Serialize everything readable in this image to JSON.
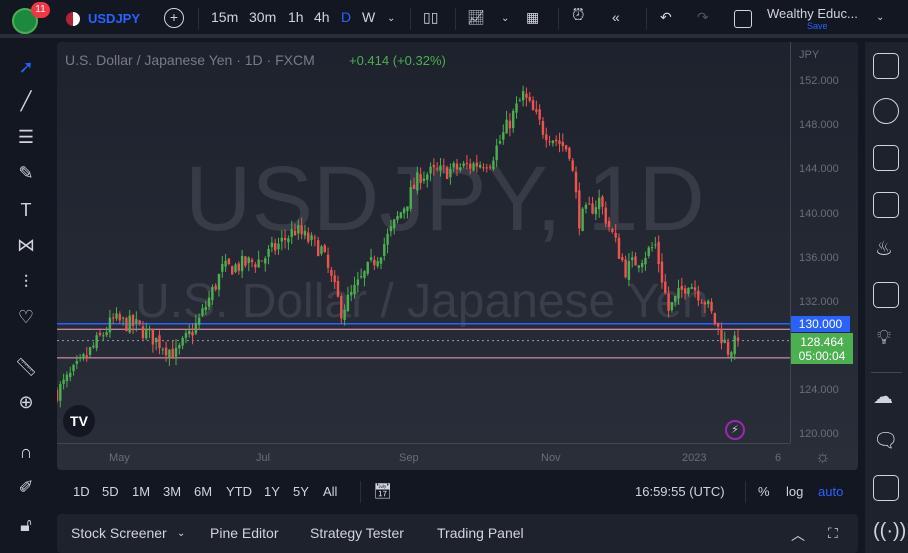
{
  "topbar": {
    "notif_count": "11",
    "symbol": "USDJPY",
    "intervals": [
      "15m",
      "30m",
      "1h",
      "4h",
      "D",
      "W"
    ],
    "layout_name": "Wealthy Educ...",
    "save_label": "Save"
  },
  "legend": {
    "title": "U.S. Dollar / Japanese Yen · 1D · FXCM",
    "change": "+0.414 (+0.32%)"
  },
  "watermark": {
    "symbol": "USDJPY, 1D",
    "name": "U.S. Dollar / Japanese Yen"
  },
  "price_axis": {
    "currency": "JPY",
    "ticks": [
      "152.000",
      "148.000",
      "144.000",
      "140.000",
      "136.000",
      "132.000",
      "124.000",
      "120.000"
    ],
    "line_label": "130.000",
    "last_price": "128.464",
    "countdown": "05:00:04"
  },
  "time_axis": {
    "labels": [
      "May",
      "Jul",
      "Sep",
      "Nov",
      "2023",
      "6"
    ]
  },
  "range_bar": {
    "ranges": [
      "1D",
      "5D",
      "1M",
      "3M",
      "6M",
      "YTD",
      "1Y",
      "5Y",
      "All"
    ],
    "clock": "16:59:55 (UTC)",
    "percent": "%",
    "log": "log",
    "auto": "auto"
  },
  "bottom_panel": {
    "tabs": [
      "Stock Screener",
      "Pine Editor",
      "Strategy Tester",
      "Trading Panel"
    ]
  },
  "colors": {
    "up": "#26a69a",
    "up_bright": "#4caf50",
    "down": "#ef5350",
    "accent": "#2962ff",
    "line_blue": "#2962ff",
    "line_pink": "#f7a1c4"
  },
  "chart_data": {
    "type": "candlestick",
    "ylim": [
      120,
      152
    ],
    "hlines": [
      130,
      129.5,
      126.9
    ],
    "last": 128.464,
    "keypoints": [
      [
        0,
        123.8
      ],
      [
        7,
        126.3
      ],
      [
        17,
        130.3
      ],
      [
        24,
        129.8
      ],
      [
        36,
        127.2
      ],
      [
        43,
        130.3
      ],
      [
        50,
        134.9
      ],
      [
        62,
        135.8
      ],
      [
        72,
        138.5
      ],
      [
        80,
        136.7
      ],
      [
        86,
        131.2
      ],
      [
        98,
        136.7
      ],
      [
        110,
        143.5
      ],
      [
        119,
        143.9
      ],
      [
        131,
        144.8
      ],
      [
        141,
        150.7
      ],
      [
        147,
        147.6
      ],
      [
        155,
        145.7
      ],
      [
        158,
        139.4
      ],
      [
        164,
        141.2
      ],
      [
        172,
        134.9
      ],
      [
        181,
        137.1
      ],
      [
        185,
        131.2
      ],
      [
        191,
        133.9
      ],
      [
        196,
        132.1
      ],
      [
        203,
        127.6
      ],
      [
        206,
        128.46
      ]
    ]
  }
}
